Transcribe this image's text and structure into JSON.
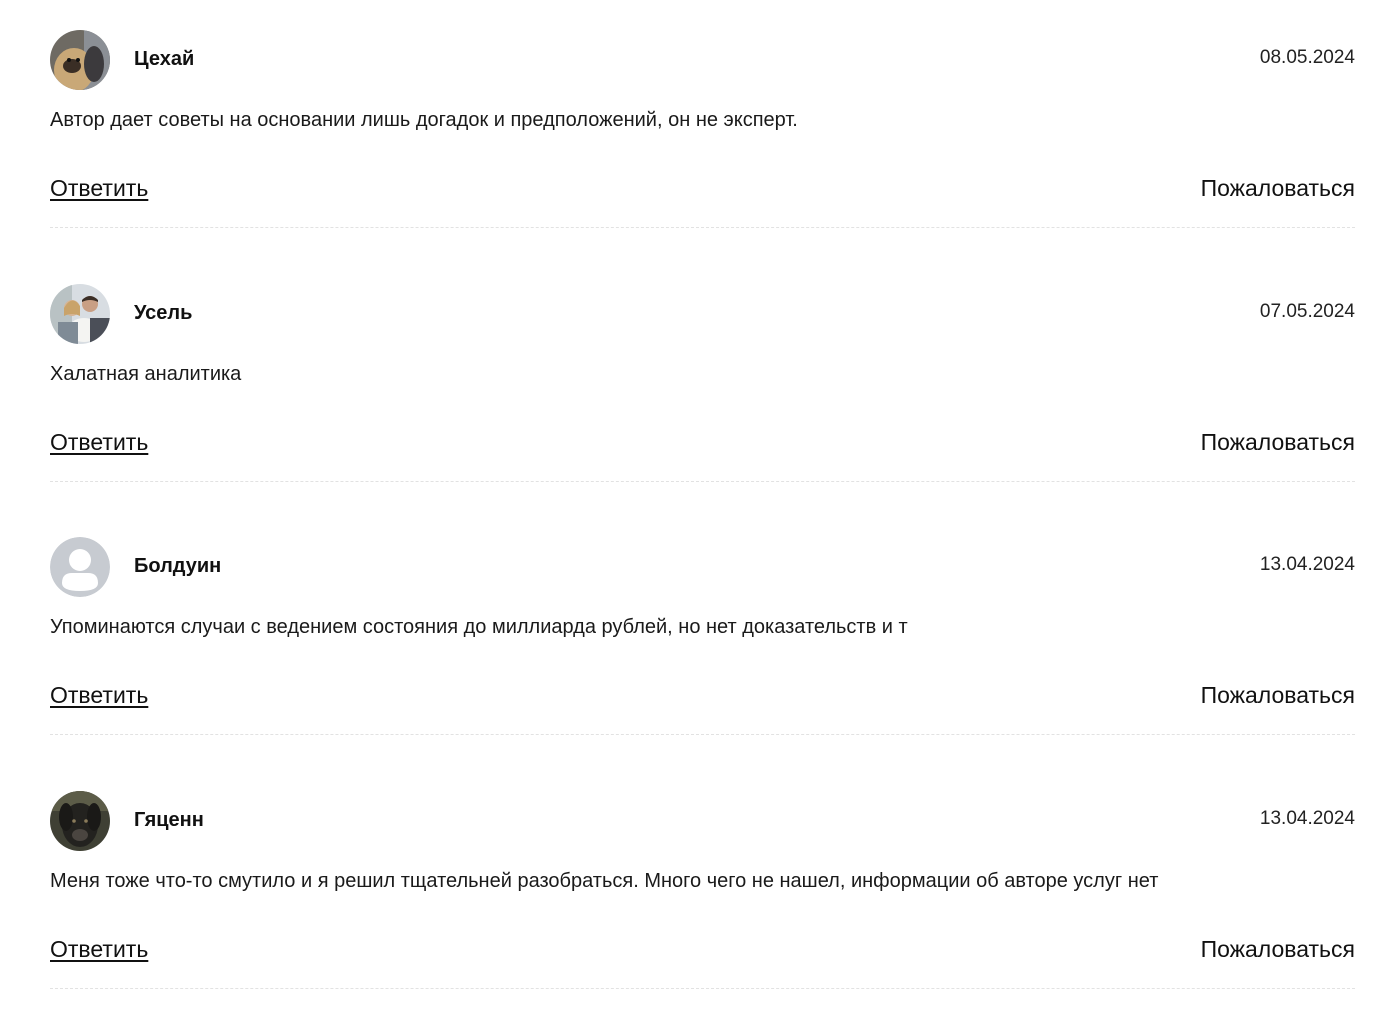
{
  "comments": [
    {
      "author": "Цехай",
      "date": "08.05.2024",
      "text": "Автор дает советы на основании лишь догадок и предположений, он не эксперт.",
      "reply_label": "Ответить",
      "report_label": "Пожаловаться",
      "avatar": "dog-photo-avatar"
    },
    {
      "author": "Усель",
      "date": "07.05.2024",
      "text": "Халатная аналитика",
      "reply_label": "Ответить",
      "report_label": "Пожаловаться",
      "avatar": "couple-with-dog-photo-avatar"
    },
    {
      "author": "Болдуин",
      "date": "13.04.2024",
      "text": "Упоминаются случаи с ведением состояния до миллиарда рублей, но нет доказательств и т",
      "reply_label": "Ответить",
      "report_label": "Пожаловаться",
      "avatar": "default-user-avatar"
    },
    {
      "author": "Гяценн",
      "date": "13.04.2024",
      "text": "Меня тоже что-то смутило и я решил тщательней разобраться. Много чего не нашел, информации об авторе услуг нет",
      "reply_label": "Ответить",
      "report_label": "Пожаловаться",
      "avatar": "dark-dog-photo-avatar"
    }
  ]
}
